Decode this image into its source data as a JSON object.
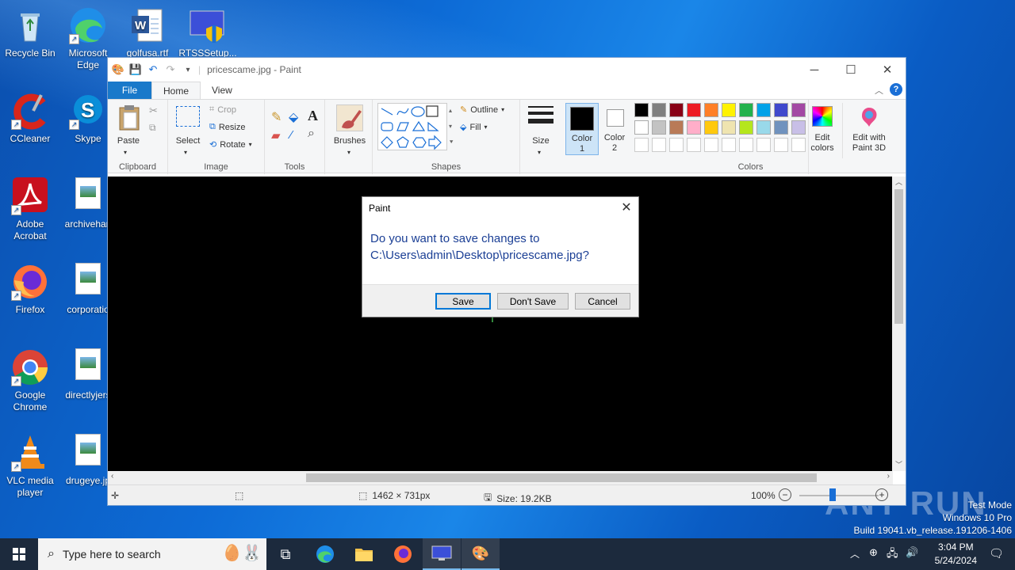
{
  "desktop": {
    "icons": [
      {
        "label": "Recycle Bin"
      },
      {
        "label": "Microsoft Edge"
      },
      {
        "label": "golfusa.rtf"
      },
      {
        "label": "RTSSSetup..."
      },
      {
        "label": "CCleaner"
      },
      {
        "label": "Skype"
      },
      {
        "label": "Adobe Acrobat"
      },
      {
        "label": "archivehan"
      },
      {
        "label": "Firefox"
      },
      {
        "label": "corporatio"
      },
      {
        "label": "Google Chrome"
      },
      {
        "label": "directlyjers"
      },
      {
        "label": "VLC media player"
      },
      {
        "label": "drugeye.jp"
      }
    ]
  },
  "paint": {
    "title": "pricescame.jpg - Paint",
    "tabs": {
      "file": "File",
      "home": "Home",
      "view": "View"
    },
    "clipboard": {
      "paste": "Paste",
      "group": "Clipboard"
    },
    "image": {
      "select": "Select",
      "crop": "Crop",
      "resize": "Resize",
      "rotate": "Rotate",
      "group": "Image"
    },
    "tools": {
      "group": "Tools"
    },
    "brushes": {
      "label": "Brushes"
    },
    "shapes": {
      "outline": "Outline",
      "fill": "Fill",
      "group": "Shapes"
    },
    "size": {
      "label": "Size"
    },
    "color1": {
      "label": "Color\n1"
    },
    "color2": {
      "label": "Color\n2"
    },
    "colors": {
      "group": "Colors",
      "edit": "Edit colors",
      "palette_row1": [
        "#000000",
        "#7f7f7f",
        "#880015",
        "#ed1c24",
        "#ff7f27",
        "#fff200",
        "#22b14c",
        "#00a2e8",
        "#3f48cc",
        "#a349a4"
      ],
      "palette_row2": [
        "#ffffff",
        "#c3c3c3",
        "#b97a57",
        "#ffaec9",
        "#ffc90e",
        "#efe4b0",
        "#b5e61d",
        "#99d9ea",
        "#7092be",
        "#c8bfe7"
      ]
    },
    "paint3d": {
      "label": "Edit with Paint 3D"
    },
    "status": {
      "dimensions": "1462 × 731px",
      "size": "Size: 19.2KB",
      "zoom": "100%"
    }
  },
  "dialog": {
    "title": "Paint",
    "message_line1": "Do you want to save changes to",
    "message_line2": "C:\\Users\\admin\\Desktop\\pricescame.jpg?",
    "save": "Save",
    "dont_save": "Don't Save",
    "cancel": "Cancel"
  },
  "taskbar": {
    "search_placeholder": "Type here to search",
    "time": "3:04 PM",
    "date": "5/24/2024"
  },
  "watermark": {
    "line1": "Test Mode",
    "line2": "Windows 10 Pro",
    "line3": "Build 19041.vb_release.191206-1406",
    "brand": "ANY RUN"
  }
}
